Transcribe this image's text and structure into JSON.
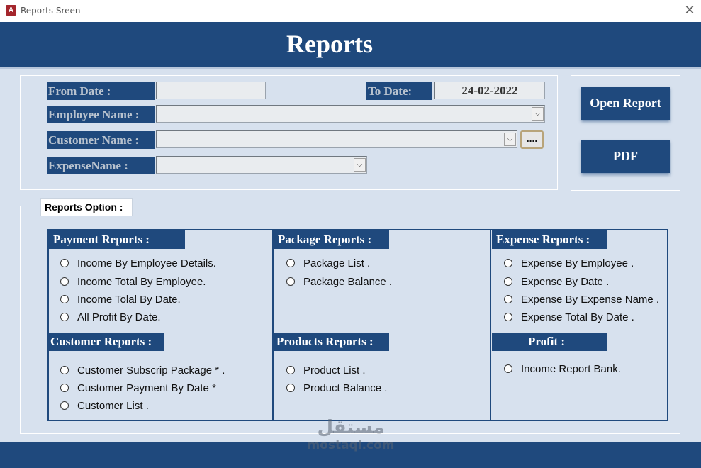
{
  "window": {
    "title": "Reports Sreen",
    "icon": "access-app-icon",
    "close_glyph": "✕"
  },
  "header": {
    "title": "Reports"
  },
  "filters": {
    "from_date_label": "From Date :",
    "from_date_value": "",
    "to_date_label": "To Date:",
    "to_date_value": "24-02-2022",
    "employee_label": "Employee Name :",
    "employee_value": "",
    "customer_label": "Customer Name :",
    "customer_value": "",
    "expense_label": "ExpenseName :",
    "expense_value": "",
    "browse_label": "...."
  },
  "actions": {
    "open_report": "Open Report",
    "pdf": "PDF"
  },
  "options": {
    "group_label": "Reports Option :",
    "payment": {
      "title": "Payment Reports :",
      "items": [
        "Income By Employee Details.",
        "Income Total By Employee.",
        "Income Tolal By Date.",
        "All Profit By Date."
      ]
    },
    "package": {
      "title": "Package Reports :",
      "items": [
        "Package List .",
        "Package Balance ."
      ]
    },
    "expense": {
      "title": "Expense Reports :",
      "items": [
        "Expense By Employee .",
        "Expense By Date .",
        "Expense By Expense Name .",
        "Expense Total By Date ."
      ]
    },
    "customer": {
      "title": "Customer Reports :",
      "items": [
        "Customer Subscrip Package * .",
        "Customer Payment By Date *",
        "Customer List ."
      ]
    },
    "products": {
      "title": "Products Reports :",
      "items": [
        "Product List .",
        "Product Balance ."
      ]
    },
    "profit": {
      "title": "Profit :",
      "items": [
        "Income Report Bank."
      ]
    }
  },
  "watermark": {
    "arabic": "مستقل",
    "latin": "mostaql.com"
  },
  "colors": {
    "accent": "#1f497d",
    "background": "#d7e1ee",
    "label_text": "#b9c3cf"
  }
}
